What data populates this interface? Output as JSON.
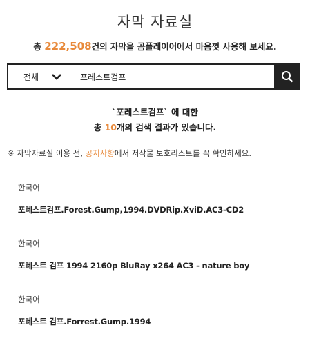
{
  "header": {
    "title": "자막 자료실",
    "subtitle_prefix": "총 ",
    "subtitle_count": "222,508",
    "subtitle_suffix": "건의 자막을 곰플레이어에서 마음껏 사용해 보세요."
  },
  "search": {
    "category": "전체",
    "query": "포레스트검프"
  },
  "result": {
    "line1": "`포레스트검프` 에 대한",
    "line2_prefix": "총 ",
    "line2_count": "10",
    "line2_suffix": "개의 검색 결과가 있습니다."
  },
  "notice": {
    "prefix": "※ 자막자료실 이용 전, ",
    "link": "공지사항",
    "suffix": "에서 저작물 보호리스트를 꼭 확인하세요."
  },
  "items": [
    {
      "lang": "한국어",
      "name": "포레스트검프.Forest.Gump,1994.DVDRip.XviD.AC3-CD2"
    },
    {
      "lang": "한국어",
      "name": "포레스트 검프 1994 2160p BluRay x264 AC3 - nature boy"
    },
    {
      "lang": "한국어",
      "name": "포레스트 검프.Forrest.Gump.1994"
    }
  ],
  "colors": {
    "accent": "#e8893a",
    "dark": "#222222"
  },
  "icons": {
    "dropdown": "chevron-down-icon",
    "search": "search-icon"
  }
}
